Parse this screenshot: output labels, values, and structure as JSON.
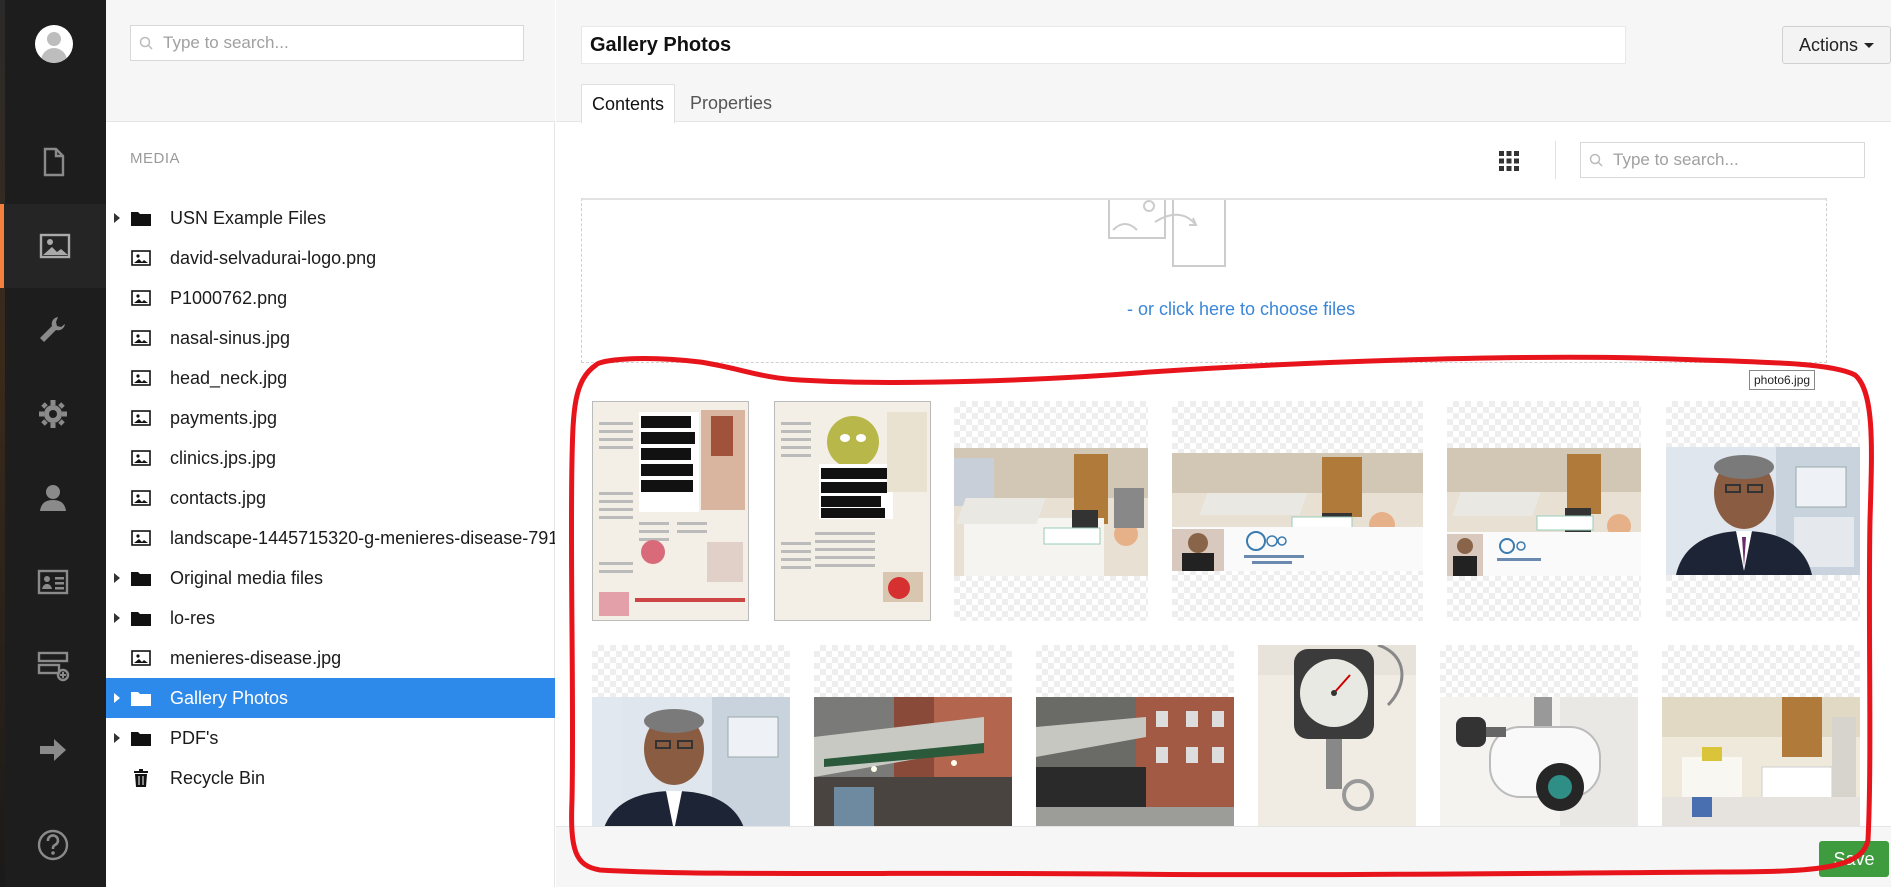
{
  "tree": {
    "search_placeholder": "Type to search...",
    "section_label": "MEDIA",
    "items": [
      {
        "label": "USN Example Files",
        "type": "folder",
        "expandable": true
      },
      {
        "label": "david-selvadurai-logo.png",
        "type": "image"
      },
      {
        "label": "P1000762.png",
        "type": "image"
      },
      {
        "label": "nasal-sinus.jpg",
        "type": "image"
      },
      {
        "label": "head_neck.jpg",
        "type": "image"
      },
      {
        "label": "payments.jpg",
        "type": "image"
      },
      {
        "label": "clinics.jps.jpg",
        "type": "image"
      },
      {
        "label": "contacts.jpg",
        "type": "image"
      },
      {
        "label": "landscape-1445715320-g-menieres-disease-791",
        "type": "image"
      },
      {
        "label": "Original media files",
        "type": "folder",
        "expandable": true
      },
      {
        "label": "lo-res",
        "type": "folder",
        "expandable": true
      },
      {
        "label": "menieres-disease.jpg",
        "type": "image"
      },
      {
        "label": "Gallery Photos",
        "type": "folder",
        "expandable": true,
        "selected": true
      },
      {
        "label": "PDF's",
        "type": "folder",
        "expandable": true
      },
      {
        "label": "Recycle Bin",
        "type": "trash"
      }
    ]
  },
  "header": {
    "name": "Gallery Photos",
    "actions_label": "Actions",
    "tabs": [
      {
        "label": "Contents",
        "active": true
      },
      {
        "label": "Properties",
        "active": false
      }
    ]
  },
  "content": {
    "search_placeholder": "Type to search...",
    "dropzone_link": "- or click here to choose files",
    "tooltip": "photo6.jpg"
  },
  "footer": {
    "save_label": "Save"
  },
  "colors": {
    "accent": "#2e8aea",
    "nav_active": "#f5803e",
    "save": "#3e9b3e",
    "annotation": "#e8141c"
  }
}
